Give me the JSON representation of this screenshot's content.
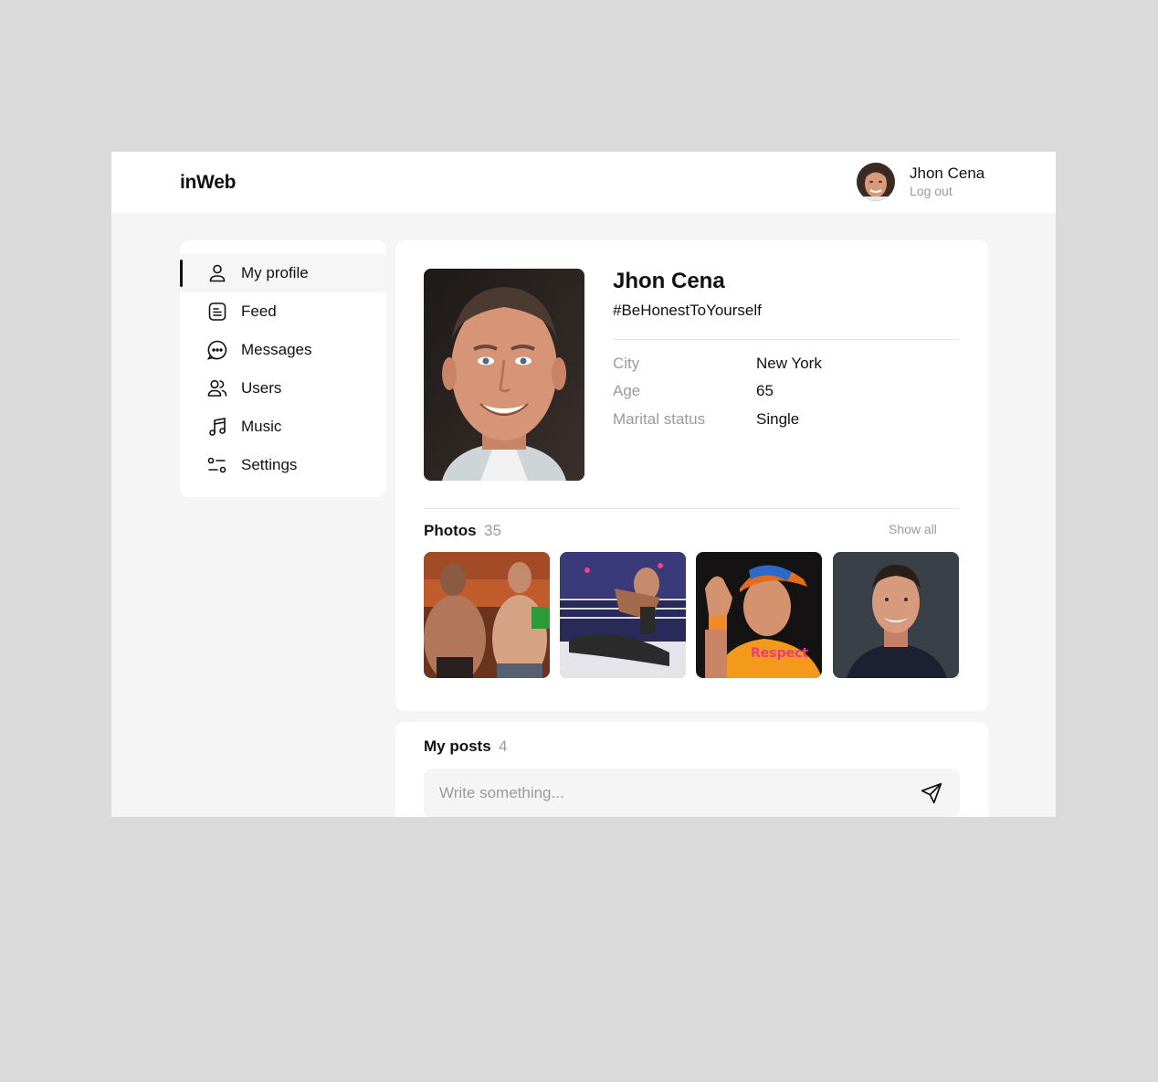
{
  "header": {
    "logo": "inWeb",
    "user_name": "Jhon Cena",
    "logout_label": "Log out"
  },
  "sidebar": {
    "items": [
      {
        "label": "My profile",
        "icon": "user-icon",
        "active": true
      },
      {
        "label": "Feed",
        "icon": "document-icon",
        "active": false
      },
      {
        "label": "Messages",
        "icon": "chat-bubble-icon",
        "active": false
      },
      {
        "label": "Users",
        "icon": "users-icon",
        "active": false
      },
      {
        "label": "Music",
        "icon": "music-note-icon",
        "active": false
      },
      {
        "label": "Settings",
        "icon": "settings-toggle-icon",
        "active": false
      }
    ]
  },
  "profile": {
    "name": "Jhon Cena",
    "status": "#BeHonestToYourself",
    "info": [
      {
        "label": "City",
        "value": "New York"
      },
      {
        "label": "Age",
        "value": "65"
      },
      {
        "label": "Marital status",
        "value": "Single"
      }
    ]
  },
  "photos": {
    "title": "Photos",
    "count": "35",
    "show_all_label": "Show all",
    "items": [
      {
        "description": "wrestlers-face-off"
      },
      {
        "description": "ring-action"
      },
      {
        "description": "orange-shirt-cap"
      },
      {
        "description": "portrait-dark-bg"
      }
    ]
  },
  "posts": {
    "title": "My posts",
    "count": "4",
    "input_placeholder": "Write something..."
  },
  "colors": {
    "page_bg": "#dadada",
    "app_bg": "#f5f5f5",
    "card_bg": "#ffffff",
    "text_primary": "#111111",
    "text_muted": "#9b9b9b",
    "active_indicator": "#111111"
  }
}
